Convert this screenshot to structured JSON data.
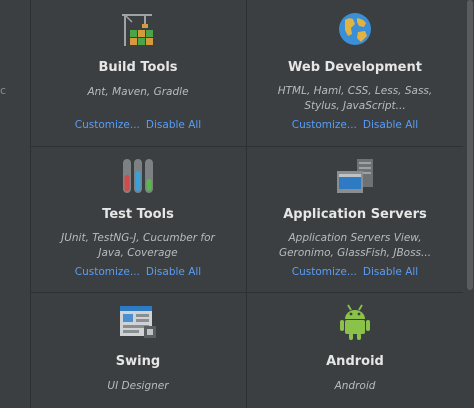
{
  "plugins": [
    {
      "title": "Build Tools",
      "desc_lines": [
        "Ant, Maven, Gradle"
      ],
      "customize": "Customize...",
      "disable": "Disable All",
      "icon": "build-tools-icon"
    },
    {
      "title": "Web Development",
      "desc_lines": [
        "HTML, Haml, CSS, Less, Sass,",
        "Stylus, JavaScript..."
      ],
      "customize": "Customize...",
      "disable": "Disable All",
      "icon": "globe-icon"
    },
    {
      "title": "Test Tools",
      "desc_lines": [
        "JUnit, TestNG-J, Cucumber for",
        "Java, Coverage"
      ],
      "customize": "Customize...",
      "disable": "Disable All",
      "icon": "test-tubes-icon"
    },
    {
      "title": "Application Servers",
      "desc_lines": [
        "Application Servers View,",
        "Geronimo, GlassFish, JBoss..."
      ],
      "customize": "Customize...",
      "disable": "Disable All",
      "icon": "server-icon"
    },
    {
      "title": "Swing",
      "desc_lines": [
        "UI Designer"
      ],
      "icon": "swing-designer-icon"
    },
    {
      "title": "Android",
      "desc_lines": [
        "Android"
      ],
      "icon": "android-icon"
    }
  ],
  "left_strip_text": "c",
  "colors": {
    "background": "#3c3f41",
    "link": "#589df6",
    "title": "#e6e6e6",
    "desc": "#b9bbbd"
  }
}
